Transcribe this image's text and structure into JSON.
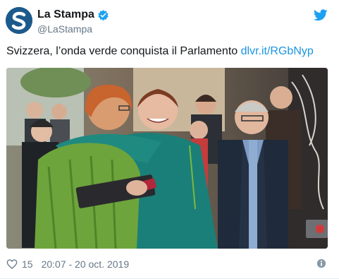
{
  "author": {
    "display_name": "La Stampa",
    "handle": "@LaStampa",
    "avatar_icon": "la-stampa-logo-icon",
    "verified_icon": "verified-badge-icon"
  },
  "tweet": {
    "text": "Svizzera, l’onda verde conquista il Parlamento ",
    "link_text": "dlvr.it/RGbNyp"
  },
  "media": {
    "description_icon": "photo-image"
  },
  "footer": {
    "like_count": "15",
    "timestamp": "20:07 - 20 oct. 2019",
    "heart_icon": "heart-icon",
    "info_icon": "info-icon"
  },
  "colors": {
    "link": "#1b95e0",
    "twitter_blue": "#1da1f2",
    "meta_gray": "#657786",
    "avatar_bg": "#1d5a8c"
  }
}
